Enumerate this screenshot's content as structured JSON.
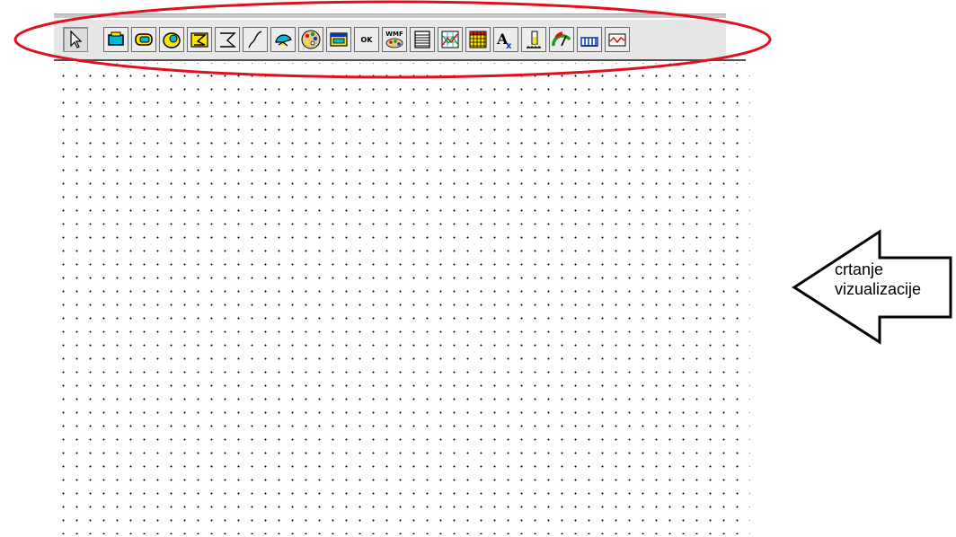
{
  "toolbar": {
    "tools": [
      {
        "name": "select-pointer",
        "icon": "pointer-arrow-icon",
        "selected": true
      },
      {
        "name": "rectangle",
        "icon": "rectangle-tool-icon"
      },
      {
        "name": "rounded-rectangle",
        "icon": "rounded-rectangle-tool-icon"
      },
      {
        "name": "ellipse",
        "icon": "ellipse-tool-icon"
      },
      {
        "name": "polygon",
        "icon": "polygon-tool-icon"
      },
      {
        "name": "polyline",
        "icon": "polyline-tool-icon"
      },
      {
        "name": "curve",
        "icon": "curve-tool-icon"
      },
      {
        "name": "pie",
        "icon": "pie-tool-icon"
      },
      {
        "name": "bitmap",
        "icon": "palette-bitmap-icon"
      },
      {
        "name": "visualization-element",
        "icon": "visualization-window-icon"
      },
      {
        "name": "button",
        "icon": "ok-button-icon",
        "label": "OK"
      },
      {
        "name": "wmf-file",
        "icon": "wmf-file-icon",
        "label": "WMF"
      },
      {
        "name": "table",
        "icon": "table-tool-icon"
      },
      {
        "name": "trend",
        "icon": "trend-chart-icon"
      },
      {
        "name": "array",
        "icon": "array-grid-icon"
      },
      {
        "name": "activex",
        "icon": "activex-icon"
      },
      {
        "name": "bar-display",
        "icon": "bar-display-icon"
      },
      {
        "name": "meter",
        "icon": "meter-gauge-icon"
      },
      {
        "name": "histogram",
        "icon": "histogram-icon"
      },
      {
        "name": "alarm-table",
        "icon": "alarm-table-icon"
      }
    ]
  },
  "annotation": {
    "line1": "crtanje",
    "line2": "vizualizacije",
    "ellipse_color": "#e0101e"
  }
}
